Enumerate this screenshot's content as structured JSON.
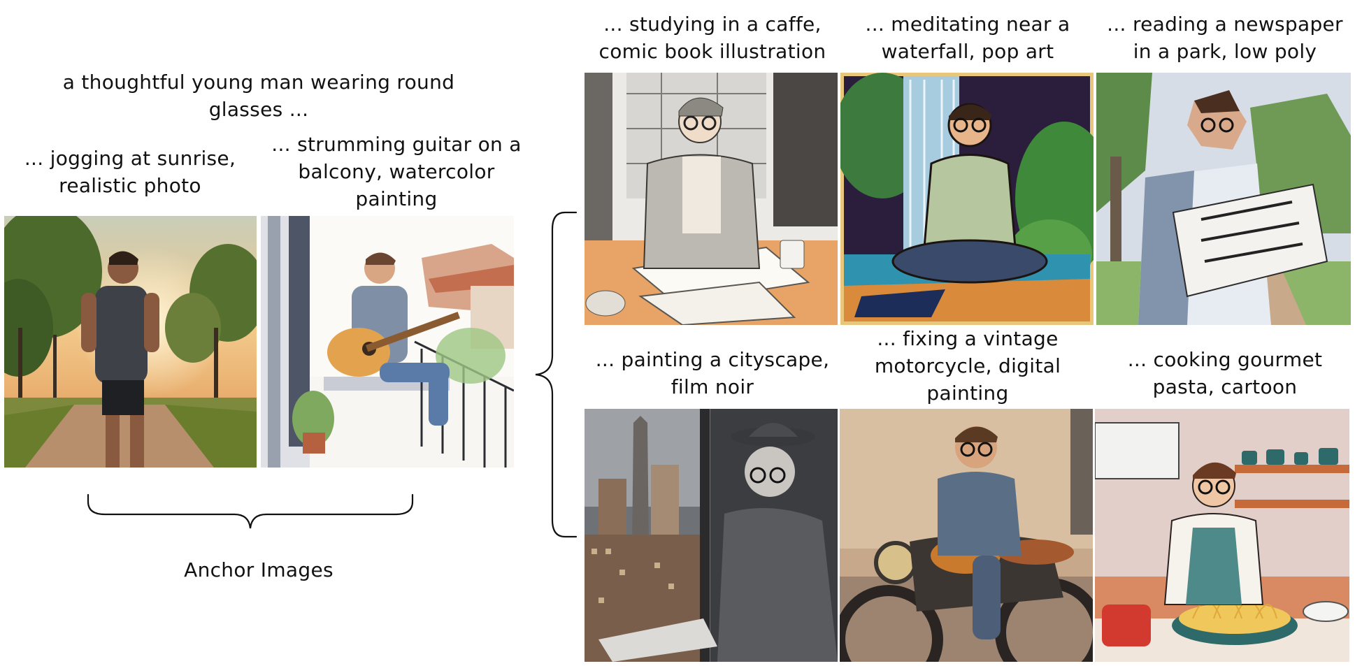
{
  "prompt_base": "a thoughtful young man wearing round\nglasses ...",
  "anchor_label": "Anchor Images",
  "anchors": [
    {
      "caption": "... jogging at sunrise,\nrealistic photo"
    },
    {
      "caption": "... strumming guitar on a\nbalcony, watercolor\npainting"
    }
  ],
  "generated": [
    {
      "caption": "... studying in a caffe,\ncomic book illustration"
    },
    {
      "caption": "... meditating near a\nwaterfall, pop art"
    },
    {
      "caption": "... reading a newspaper\nin a park, low poly"
    },
    {
      "caption": "... painting a cityscape,\nfilm noir"
    },
    {
      "caption": "... fixing a vintage\nmotorcycle, digital\npainting"
    },
    {
      "caption": "... cooking gourmet\npasta, cartoon"
    }
  ]
}
